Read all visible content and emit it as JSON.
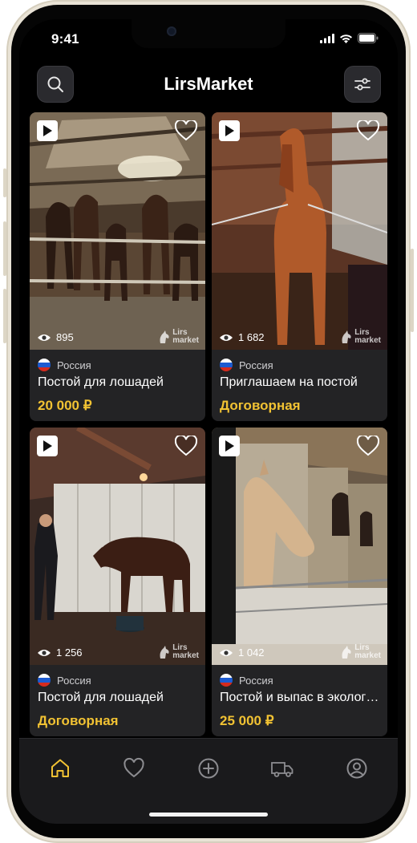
{
  "status_bar": {
    "time": "9:41"
  },
  "header": {
    "title": "LirsMarket"
  },
  "brand_colors": {
    "price": "#f1c233",
    "active_tab": "#f1c233",
    "inactive_tab": "#8c8c90"
  },
  "listings": [
    {
      "views": "895",
      "country": "Россия",
      "title": "Постой для лошадей",
      "price": "20 000 ₽",
      "watermark_line1": "Lirs",
      "watermark_line2": "market"
    },
    {
      "views": "1 682",
      "country": "Россия",
      "title": "Приглашаем на постой",
      "price": "Договорная",
      "watermark_line1": "Lirs",
      "watermark_line2": "market"
    },
    {
      "views": "1 256",
      "country": "Россия",
      "title": "Постой для лошадей",
      "price": "Договорная",
      "watermark_line1": "Lirs",
      "watermark_line2": "market"
    },
    {
      "views": "1 042",
      "country": "Россия",
      "title": "Постой и выпас в экологи…",
      "price": "25 000 ₽",
      "watermark_line1": "Lirs",
      "watermark_line2": "market"
    }
  ],
  "tab_bar": {
    "tabs": [
      {
        "icon": "home-icon",
        "active": true
      },
      {
        "icon": "heart-icon",
        "active": false
      },
      {
        "icon": "plus-circle-icon",
        "active": false
      },
      {
        "icon": "truck-icon",
        "active": false
      },
      {
        "icon": "profile-icon",
        "active": false
      }
    ]
  }
}
